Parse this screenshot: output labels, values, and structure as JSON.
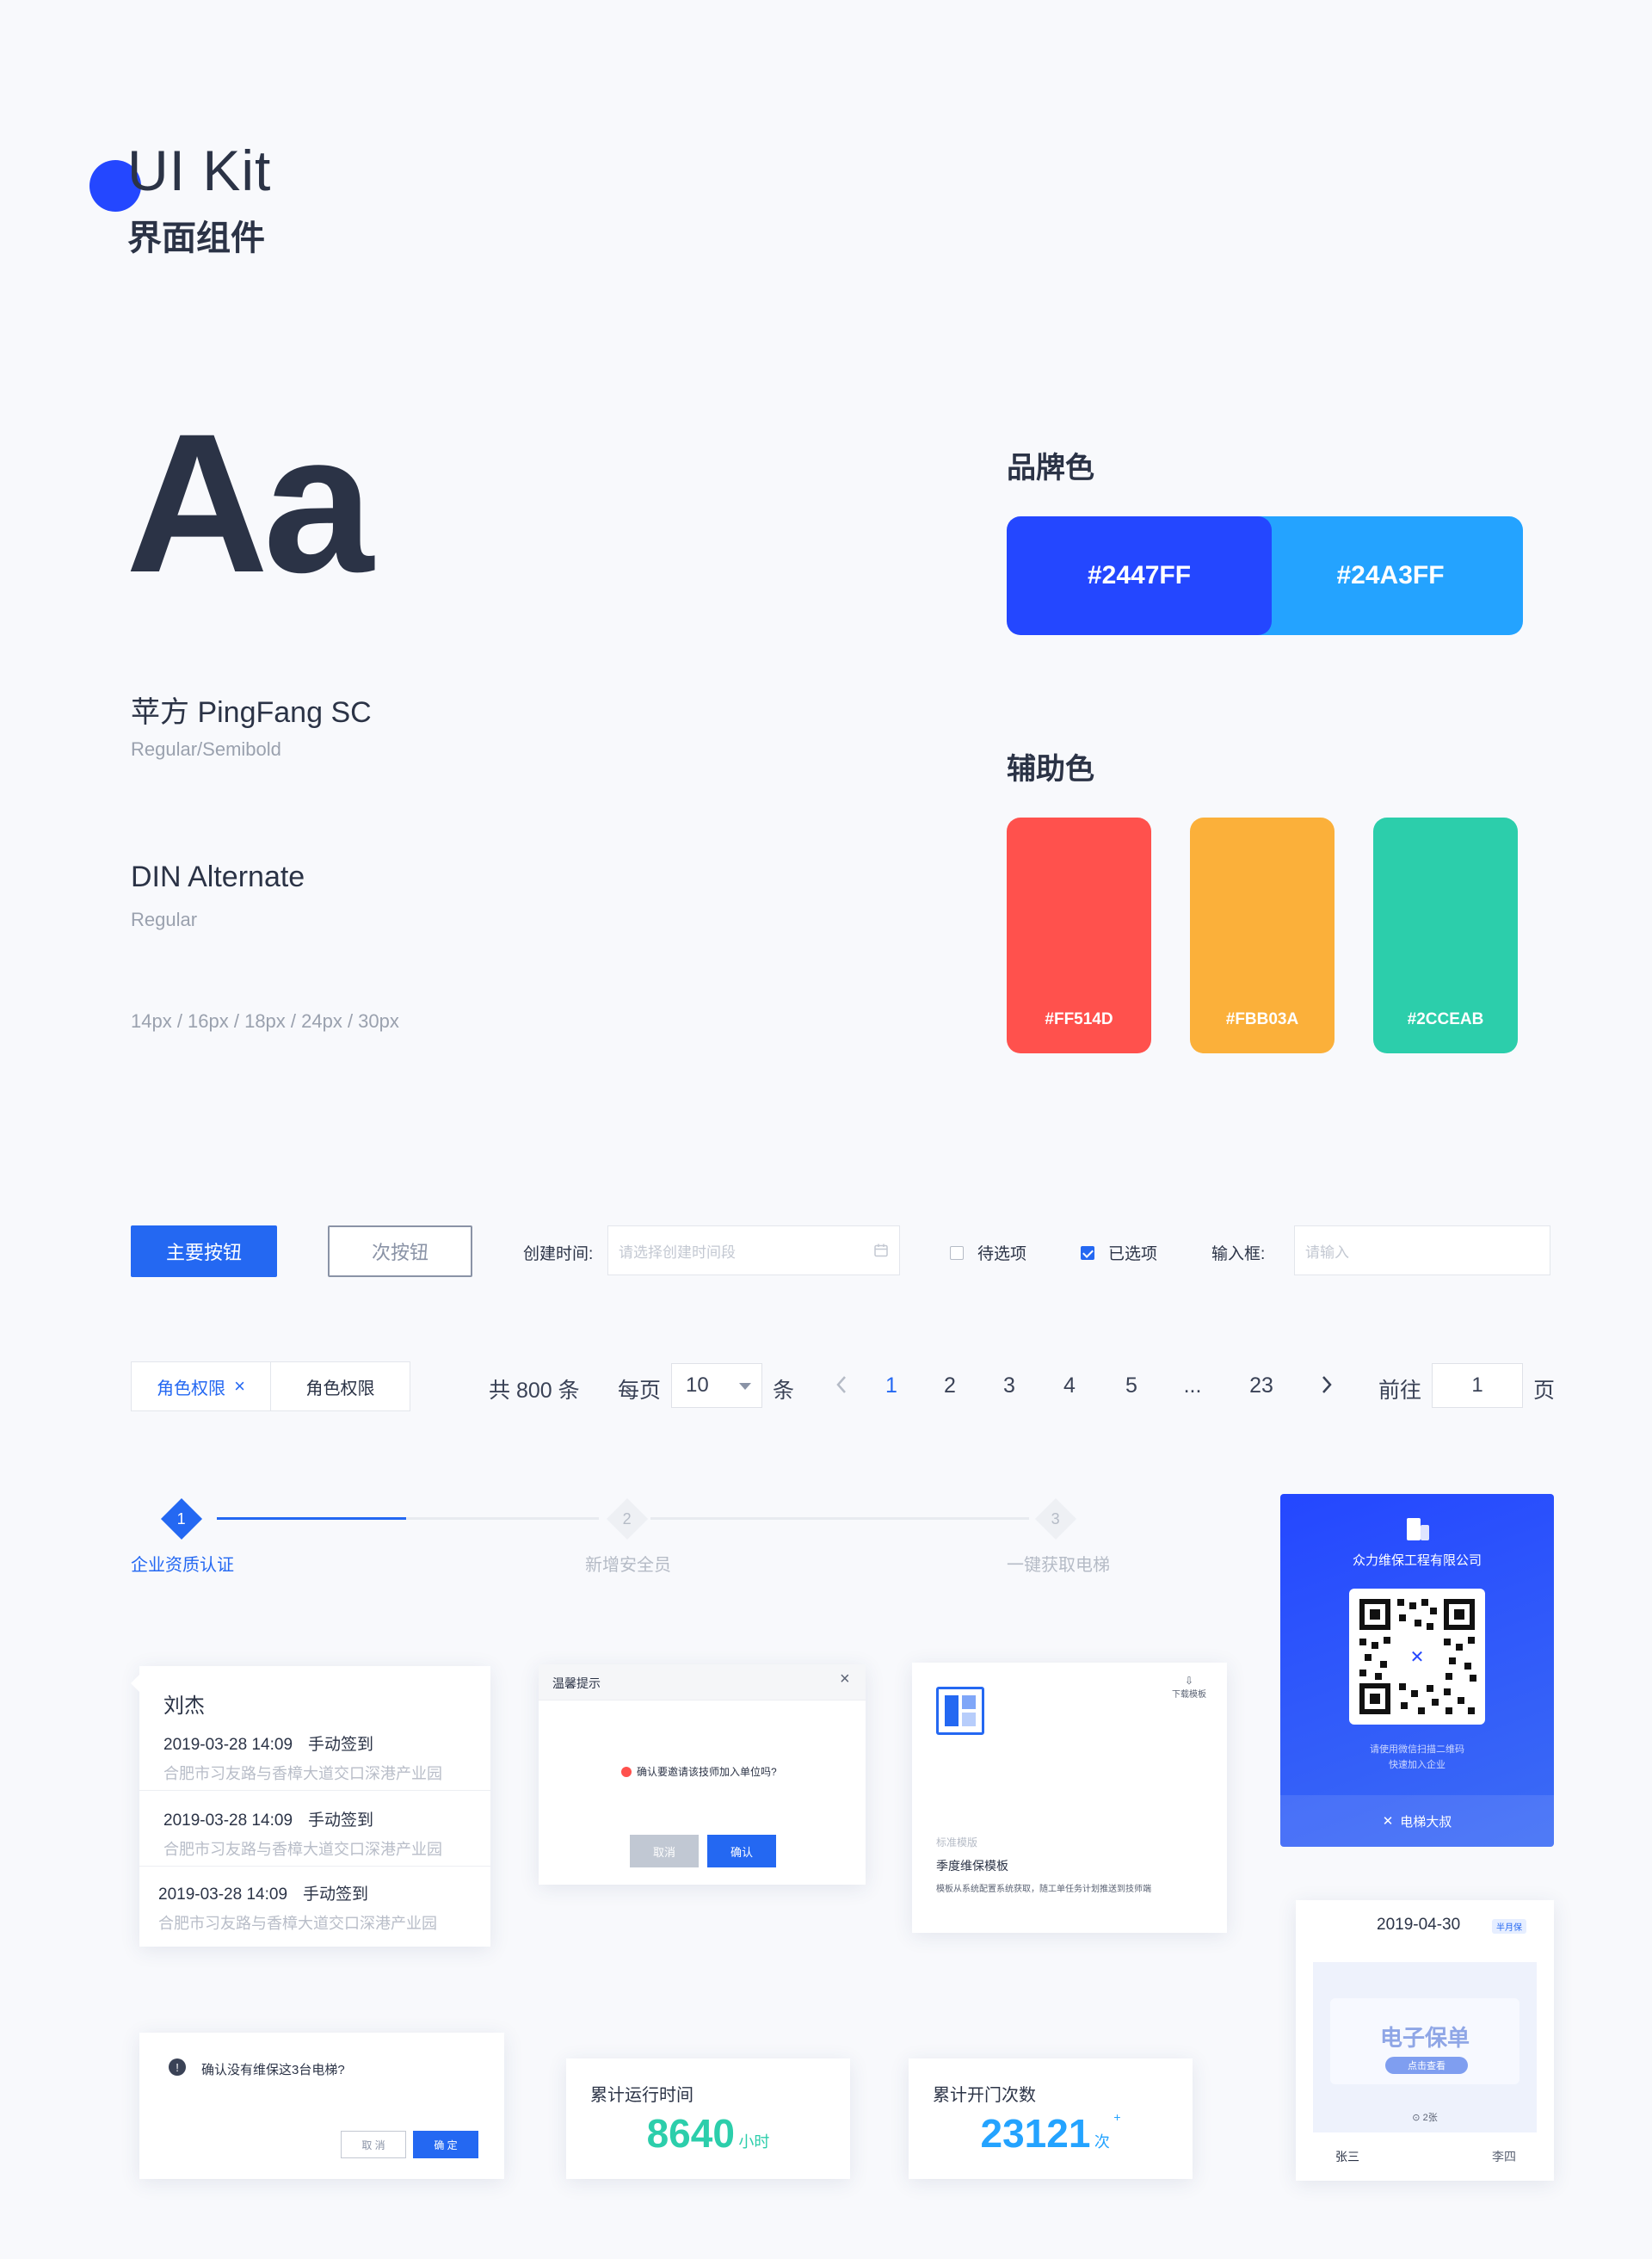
{
  "header": {
    "title": "UI Kit",
    "subtitle": "界面组件"
  },
  "typography": {
    "sample": "Aa",
    "font1_name": "苹方 PingFang SC",
    "font1_weights": "Regular/Semibold",
    "font2_name": "DIN Alternate",
    "font2_weights": "Regular",
    "sizes": "14px  /  16px  /  18px  /  24px  /  30px"
  },
  "colors": {
    "brand_title": "品牌色",
    "brand": [
      {
        "hex": "#2447FF"
      },
      {
        "hex": "#24A3FF"
      }
    ],
    "aux_title": "辅助色",
    "aux": [
      {
        "hex": "#FF514D"
      },
      {
        "hex": "#FBB03A"
      },
      {
        "hex": "#2CCEAB"
      }
    ]
  },
  "controls": {
    "primary_btn": "主要按钮",
    "secondary_btn": "次按钮",
    "date_label": "创建时间:",
    "date_placeholder": "请选择创建时间段",
    "option_unchecked": "待选项",
    "option_checked": "已选项",
    "input_label": "输入框:",
    "input_placeholder": "请输入"
  },
  "tags": {
    "active": "角色权限",
    "inactive": "角色权限",
    "close": "×"
  },
  "pagination": {
    "total": "共 800 条",
    "per_page_label": "每页",
    "per_page_value": "10",
    "unit": "条",
    "pages": [
      "1",
      "2",
      "3",
      "4",
      "5",
      "...",
      "23"
    ],
    "current": "1",
    "goto_label": "前往",
    "goto_value": "1",
    "goto_unit": "页"
  },
  "steps": [
    {
      "num": "1",
      "label": "企业资质认证"
    },
    {
      "num": "2",
      "label": "新增安全员"
    },
    {
      "num": "3",
      "label": "一键获取电梯"
    }
  ],
  "records": {
    "name": "刘杰",
    "items": [
      {
        "time": "2019-03-28 14:09",
        "action": "手动签到",
        "address": "合肥市习友路与香樟大道交口深港产业园"
      },
      {
        "time": "2019-03-28 14:09",
        "action": "手动签到",
        "address": "合肥市习友路与香樟大道交口深港产业园"
      },
      {
        "time": "2019-03-28 14:09",
        "action": "手动签到",
        "address": "合肥市习友路与香樟大道交口深港产业园"
      }
    ]
  },
  "dialog": {
    "title": "温馨提示",
    "message": "确认要邀请该技师加入单位吗?",
    "cancel": "取消",
    "confirm": "确认"
  },
  "template_card": {
    "download": "下载模板",
    "tag": "标准模版",
    "title": "季度维保模板",
    "desc": "模板从系统配置系统获取，随工单任务计划推送到技师端"
  },
  "qr_card": {
    "company": "众力维保工程有限公司",
    "hint1": "请使用微信扫描二维码",
    "hint2": "快速加入企业",
    "footer": "电梯大叔"
  },
  "confirm_box": {
    "message": "确认没有维保这3台电梯?",
    "cancel": "取 消",
    "confirm": "确 定"
  },
  "stats": [
    {
      "label": "累计运行时间",
      "value": "8640",
      "unit": "小时",
      "color": "#2CCEAB"
    },
    {
      "label": "累计开门次数",
      "value": "23121",
      "unit": "次",
      "color": "#24A3FF"
    }
  ],
  "warranty": {
    "date": "2019-04-30",
    "badge": "半月保",
    "title": "电子保单",
    "button": "点击查看",
    "count": "2张",
    "left_name": "张三",
    "right_name": "李四"
  }
}
